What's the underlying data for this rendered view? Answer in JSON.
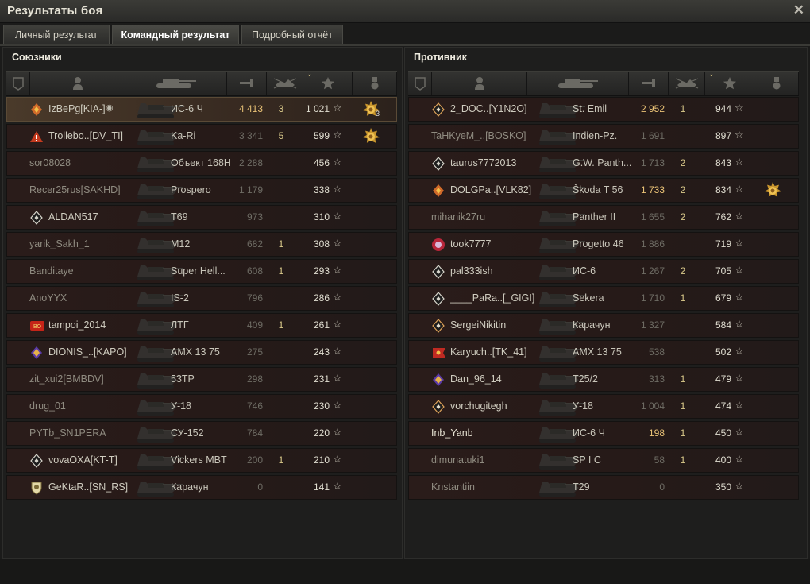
{
  "window": {
    "title": "Результаты боя",
    "close_icon": "close-icon"
  },
  "tabs": [
    {
      "label": "Личный результат",
      "active": false
    },
    {
      "label": "Командный результат",
      "active": true
    },
    {
      "label": "Подробный отчёт",
      "active": false
    }
  ],
  "columns": [
    "squad-icon",
    "player-icon",
    "vehicle-icon",
    "damage-icon",
    "frags-icon",
    "xp-star-icon",
    "medal-icon"
  ],
  "sort_indicator": "chevron-down-icon",
  "allies": {
    "title": "Союзники",
    "rows": [
      {
        "name": "IzBePg[KIA-]",
        "vehicle": "ИС-6 Ч",
        "damage": "4 413",
        "frags": "3",
        "xp": "1 021",
        "badge": "orange",
        "medal": true,
        "medal_count": "3",
        "me": true
      },
      {
        "name": "Trollebo..[DV_TI]",
        "vehicle": "Ka-Ri",
        "damage": "3 341",
        "frags": "5",
        "xp": "599",
        "badge": "warning",
        "medal": true,
        "medal_count": ""
      },
      {
        "name": "sor08028",
        "vehicle": "Объект 168Н",
        "damage": "2 288",
        "frags": "",
        "xp": "456",
        "badge": "",
        "medal": false
      },
      {
        "name": "Recer25rus[SAKHD]",
        "vehicle": "Prospero",
        "damage": "1 179",
        "frags": "",
        "xp": "338",
        "badge": "",
        "medal": false
      },
      {
        "name": "ALDAN517",
        "vehicle": "T69",
        "damage": "973",
        "frags": "",
        "xp": "310",
        "badge": "diamond",
        "medal": false
      },
      {
        "name": "yarik_Sakh_1",
        "vehicle": "M12",
        "damage": "682",
        "frags": "1",
        "xp": "308",
        "badge": "",
        "medal": false
      },
      {
        "name": "Banditaye",
        "vehicle": "Super Hell...",
        "damage": "608",
        "frags": "1",
        "xp": "293",
        "badge": "",
        "medal": false
      },
      {
        "name": "AnoYYX",
        "vehicle": "IS-2",
        "damage": "796",
        "frags": "",
        "xp": "286",
        "badge": "",
        "medal": false
      },
      {
        "name": "tampoi_2014",
        "vehicle": "ЛТГ",
        "damage": "409",
        "frags": "1",
        "xp": "261",
        "badge": "red",
        "medal": false
      },
      {
        "name": "DIONIS_..[KAPO]",
        "vehicle": "AMX 13 75",
        "damage": "275",
        "frags": "",
        "xp": "243",
        "badge": "purple",
        "medal": false
      },
      {
        "name": "zit_xui2[BMBDV]",
        "vehicle": "53TP",
        "damage": "298",
        "frags": "",
        "xp": "231",
        "badge": "",
        "medal": false
      },
      {
        "name": "drug_01",
        "vehicle": "У-18",
        "damage": "746",
        "frags": "",
        "xp": "230",
        "badge": "",
        "medal": false
      },
      {
        "name": "PYTb_SN1PERA",
        "vehicle": "СУ-152",
        "damage": "784",
        "frags": "",
        "xp": "220",
        "badge": "",
        "medal": false
      },
      {
        "name": "vovaOXA[KT-T]",
        "vehicle": "Vickers MBT",
        "damage": "200",
        "frags": "1",
        "xp": "210",
        "badge": "diamond",
        "medal": false
      },
      {
        "name": "GeKtaR..[SN_RS]",
        "vehicle": "Карачун",
        "damage": "0",
        "frags": "",
        "xp": "141",
        "badge": "shield",
        "medal": false
      }
    ]
  },
  "enemies": {
    "title": "Противник",
    "rows": [
      {
        "name": "2_DOC..[Y1N2O]",
        "vehicle": "St. Emil",
        "damage": "2 952",
        "frags": "1",
        "xp": "944",
        "badge": "diamond-orange",
        "medal": false,
        "dmg_hi": true
      },
      {
        "name": "TaHKyeM_..[BOSKO]",
        "vehicle": "Indien-Pz.",
        "damage": "1 691",
        "frags": "",
        "xp": "897",
        "badge": "",
        "medal": false
      },
      {
        "name": "taurus7772013",
        "vehicle": "G.W. Panth...",
        "damage": "1 713",
        "frags": "2",
        "xp": "843",
        "badge": "diamond",
        "medal": false
      },
      {
        "name": "DOLGPa..[VLK82]",
        "vehicle": "Škoda T 56",
        "damage": "1 733",
        "frags": "2",
        "xp": "834",
        "badge": "orange",
        "medal": true,
        "medal_count": "",
        "dmg_hi": true
      },
      {
        "name": "mihanik27ru",
        "vehicle": "Panther II",
        "damage": "1 655",
        "frags": "2",
        "xp": "762",
        "badge": "",
        "medal": false
      },
      {
        "name": "took7777",
        "vehicle": "Progetto 46",
        "damage": "1 886",
        "frags": "",
        "xp": "719",
        "badge": "redcircle",
        "medal": false
      },
      {
        "name": "pal333ish",
        "vehicle": "ИС-6",
        "damage": "1 267",
        "frags": "2",
        "xp": "705",
        "badge": "diamond",
        "medal": false
      },
      {
        "name": "____PaRa..[_GIGI]",
        "vehicle": "Sekera",
        "damage": "1 710",
        "frags": "1",
        "xp": "679",
        "badge": "diamond",
        "medal": false
      },
      {
        "name": "SergeiNikitin",
        "vehicle": "Карачун",
        "damage": "1 327",
        "frags": "",
        "xp": "584",
        "badge": "diamond-orange",
        "medal": false
      },
      {
        "name": "Karyuch..[TK_41]",
        "vehicle": "AMX 13 75",
        "damage": "538",
        "frags": "",
        "xp": "502",
        "badge": "redflag",
        "medal": false
      },
      {
        "name": "Dan_96_14",
        "vehicle": "T25/2",
        "damage": "313",
        "frags": "1",
        "xp": "479",
        "badge": "purple",
        "medal": false
      },
      {
        "name": "vorchugitegh",
        "vehicle": "У-18",
        "damage": "1 004",
        "frags": "1",
        "xp": "474",
        "badge": "diamond-orange",
        "medal": false
      },
      {
        "name": "Inb_Yanb",
        "vehicle": "ИС-6 Ч",
        "damage": "198",
        "frags": "1",
        "xp": "450",
        "badge": "",
        "medal": false,
        "dmg_hi": true,
        "name_hi": true
      },
      {
        "name": "dimunatuki1",
        "vehicle": "SP I C",
        "damage": "58",
        "frags": "1",
        "xp": "400",
        "badge": "",
        "medal": false
      },
      {
        "name": "Knstantiin",
        "vehicle": "T29",
        "damage": "0",
        "frags": "",
        "xp": "350",
        "badge": "",
        "medal": false
      }
    ]
  },
  "colors": {
    "accent": "#d8c682",
    "text": "#c8c5b9",
    "dim": "#8a877d",
    "highlight": "#ecc57a"
  }
}
